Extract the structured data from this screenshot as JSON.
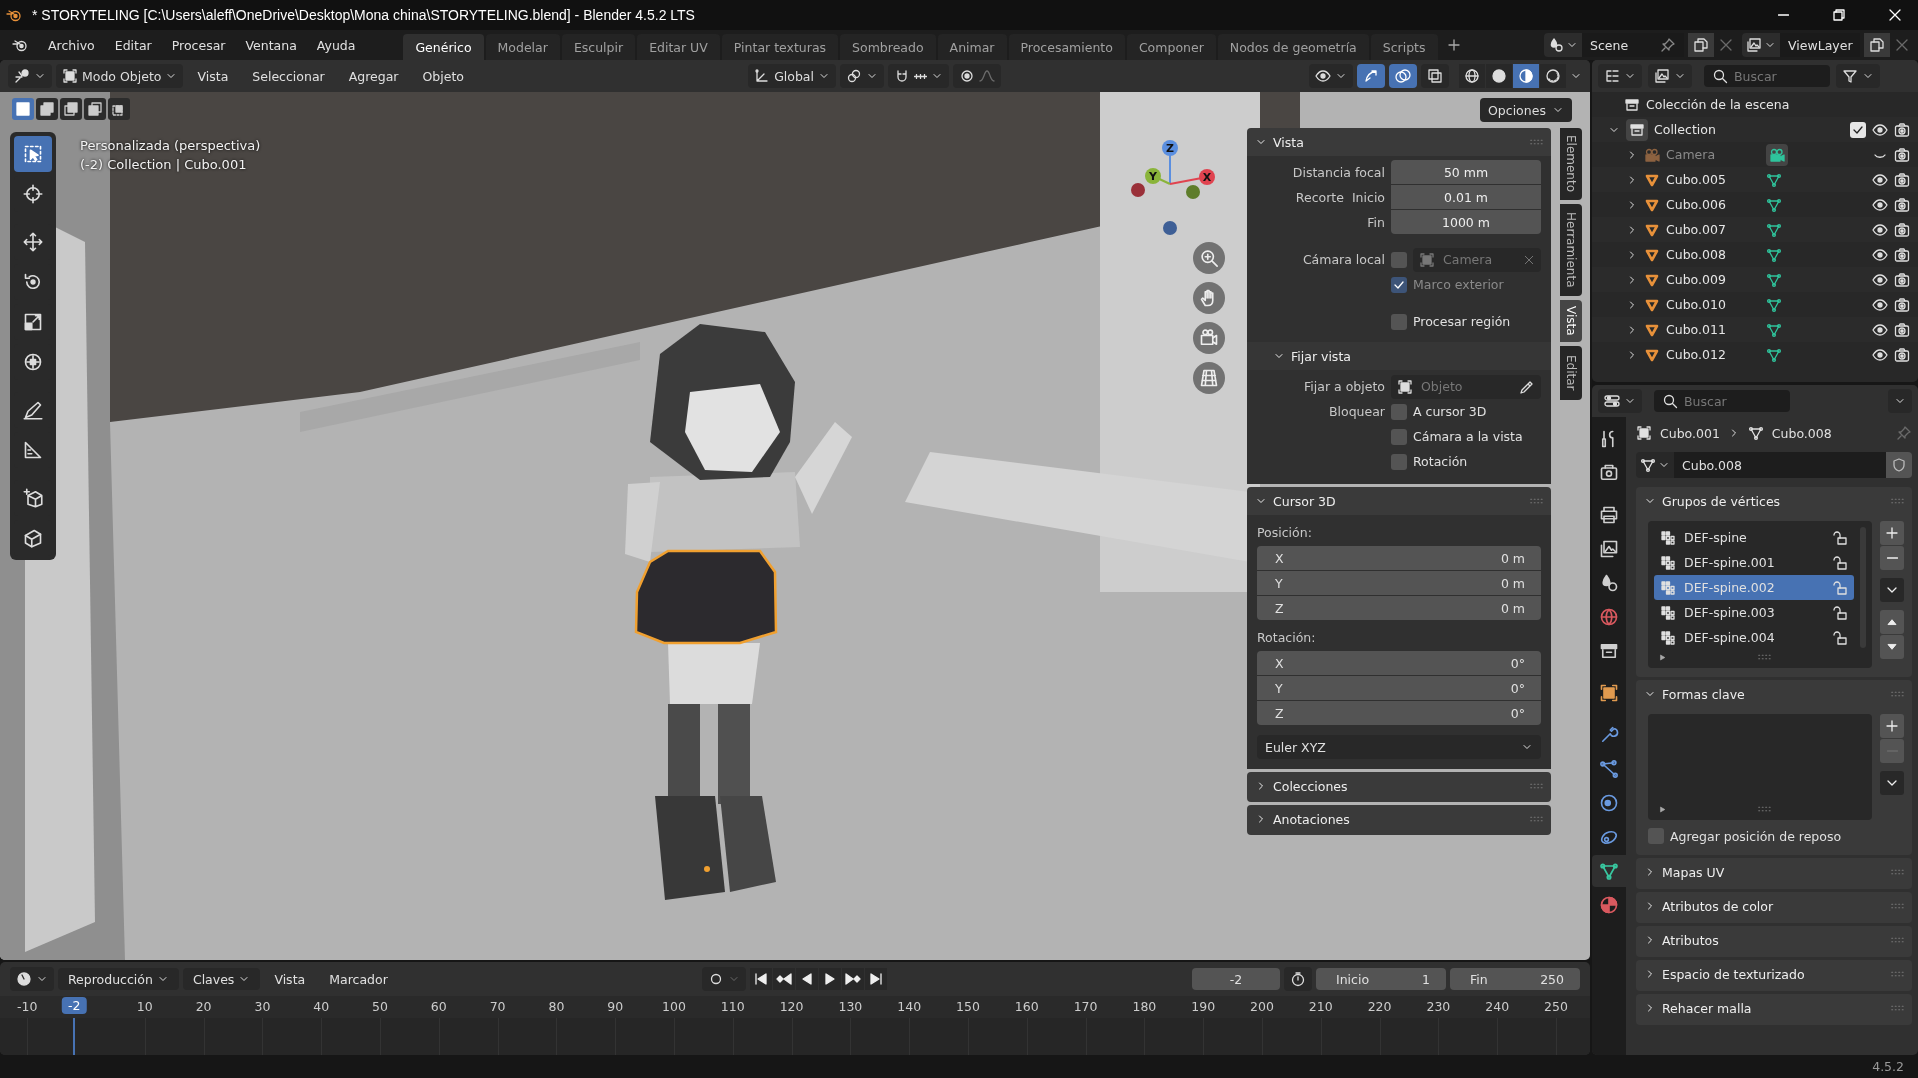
{
  "window": {
    "title": "* STORYTELING [C:\\Users\\aleff\\OneDrive\\Desktop\\Mona china\\STORYTELING.blend] - Blender 4.5.2 LTS"
  },
  "menu": [
    "Archivo",
    "Editar",
    "Procesar",
    "Ventana",
    "Ayuda"
  ],
  "workspaces": [
    {
      "label": "Genérico",
      "selected": true
    },
    {
      "label": "Modelar",
      "selected": false
    },
    {
      "label": "Esculpir",
      "selected": false
    },
    {
      "label": "Editar UV",
      "selected": false
    },
    {
      "label": "Pintar texturas",
      "selected": false
    },
    {
      "label": "Sombreado",
      "selected": false
    },
    {
      "label": "Animar",
      "selected": false
    },
    {
      "label": "Procesamiento",
      "selected": false
    },
    {
      "label": "Componer",
      "selected": false
    },
    {
      "label": "Nodos de geometría",
      "selected": false
    },
    {
      "label": "Scripts",
      "selected": false
    }
  ],
  "scene": {
    "name": "Scene"
  },
  "view_layer": {
    "name": "ViewLayer"
  },
  "viewport": {
    "mode": "Modo Objeto",
    "menus": [
      "Vista",
      "Seleccionar",
      "Agregar",
      "Objeto"
    ],
    "orientation": "Global",
    "options": "Opciones",
    "info": [
      "Personalizada (perspectiva)",
      "(-2) Collection | Cubo.001"
    ],
    "select_modes": [
      {
        "kind": "set",
        "selected": true
      },
      {
        "kind": "extend",
        "selected": false
      },
      {
        "kind": "subtract",
        "selected": false
      },
      {
        "kind": "invert",
        "selected": false
      },
      {
        "kind": "intersect",
        "selected": false
      }
    ],
    "tools": [
      {
        "kind": "select",
        "selected": true
      },
      {
        "kind": "crosshair",
        "selected": false
      },
      {
        "kind": "move",
        "selected": false
      },
      {
        "kind": "rotate",
        "selected": false
      },
      {
        "kind": "scale",
        "selected": false
      },
      {
        "kind": "transform",
        "selected": false
      },
      {
        "kind": "pencil",
        "selected": false
      },
      {
        "kind": "ruler",
        "selected": false
      },
      {
        "kind": "add-cube",
        "selected": false
      },
      {
        "kind": "cube-shear",
        "selected": false
      }
    ],
    "toggles": [
      {
        "kind": "gizmo",
        "on": true
      },
      {
        "kind": "overlay",
        "on": true
      },
      {
        "kind": "xray",
        "on": false
      }
    ],
    "shading": [
      {
        "kind": "wireframe",
        "selected": false
      },
      {
        "kind": "solid",
        "selected": false
      },
      {
        "kind": "material",
        "selected": true
      },
      {
        "kind": "rendered",
        "selected": false
      }
    ],
    "gizmo_axes": [
      "X",
      "Y",
      "Z"
    ]
  },
  "sidebar": {
    "tabs": [
      {
        "label": "Elemento",
        "selected": false
      },
      {
        "label": "Herramienta",
        "selected": false
      },
      {
        "label": "Vista",
        "selected": true
      },
      {
        "label": "Editar",
        "selected": false
      }
    ],
    "panels": [
      {
        "kind": "view",
        "title": "Vista",
        "expanded": true,
        "fields": [
          {
            "label": "Distancia focal",
            "value": "50 mm"
          },
          {
            "group": "Recorte",
            "label": "Inicio",
            "value": "0.01 m"
          },
          {
            "label": "Fin",
            "value": "1000 m"
          }
        ],
        "local_camera": {
          "label": "Cámara local",
          "checked": false,
          "placeholder": "Camera"
        },
        "options": [
          {
            "label": "Marco exterior",
            "checked": true,
            "disabled": true
          },
          {
            "label": "Procesar región",
            "checked": false,
            "disabled": false
          }
        ],
        "sub": {
          "title": "Fijar vista",
          "expanded": true,
          "object_label": "Fijar a objeto",
          "object_placeholder": "Objeto",
          "lock_label": "Bloquear",
          "locks": [
            {
              "label": "A cursor 3D",
              "checked": false
            },
            {
              "label": "Cámara a la vista",
              "checked": false
            },
            {
              "label": "Rotación",
              "checked": false
            }
          ]
        }
      },
      {
        "kind": "cursor",
        "title": "Cursor 3D",
        "expanded": true,
        "position_label": "Posición:",
        "position": [
          {
            "axis": "X",
            "value": "0 m"
          },
          {
            "axis": "Y",
            "value": "0 m"
          },
          {
            "axis": "Z",
            "value": "0 m"
          }
        ],
        "rotation_label": "Rotación:",
        "rotation": [
          {
            "axis": "X",
            "value": "0°"
          },
          {
            "axis": "Y",
            "value": "0°"
          },
          {
            "axis": "Z",
            "value": "0°"
          }
        ],
        "rotation_mode": "Euler XYZ"
      },
      {
        "kind": "collapsed",
        "title": "Colecciones",
        "expanded": false
      },
      {
        "kind": "collapsed",
        "title": "Anotaciones",
        "expanded": false
      }
    ]
  },
  "outliner": {
    "search_placeholder": "Buscar",
    "root": "Colección de la escena",
    "collection": {
      "label": "Collection",
      "expanded": true,
      "checked": true,
      "hidden": false,
      "children": [
        {
          "label": "Camera",
          "kind": "camera",
          "expanded": false,
          "hidden": true
        },
        {
          "label": "Cubo.005",
          "kind": "mesh",
          "expanded": false,
          "hidden": false
        },
        {
          "label": "Cubo.006",
          "kind": "mesh",
          "expanded": false,
          "hidden": false
        },
        {
          "label": "Cubo.007",
          "kind": "mesh",
          "expanded": false,
          "hidden": false
        },
        {
          "label": "Cubo.008",
          "kind": "mesh",
          "expanded": false,
          "hidden": false
        },
        {
          "label": "Cubo.009",
          "kind": "mesh",
          "expanded": false,
          "hidden": false
        },
        {
          "label": "Cubo.010",
          "kind": "mesh",
          "expanded": false,
          "hidden": false
        },
        {
          "label": "Cubo.011",
          "kind": "mesh",
          "expanded": false,
          "hidden": false
        },
        {
          "label": "Cubo.012",
          "kind": "mesh",
          "expanded": false,
          "hidden": false
        }
      ]
    }
  },
  "properties": {
    "search_placeholder": "Buscar",
    "tabs": [
      {
        "kind": "tool",
        "selected": false
      },
      {
        "kind": "render",
        "selected": false
      },
      {
        "kind": "output",
        "selected": false
      },
      {
        "kind": "view-layer",
        "selected": false
      },
      {
        "kind": "scene",
        "selected": false
      },
      {
        "kind": "world",
        "selected": false
      },
      {
        "kind": "collection",
        "selected": false
      },
      {
        "kind": "object",
        "selected": false
      },
      {
        "kind": "modifier",
        "selected": false
      },
      {
        "kind": "particles",
        "selected": false
      },
      {
        "kind": "physics",
        "selected": false
      },
      {
        "kind": "constraints",
        "selected": false
      },
      {
        "kind": "data",
        "selected": true
      },
      {
        "kind": "material",
        "selected": false
      }
    ],
    "object": "Cubo.001",
    "data": "Cubo.008",
    "data_name": "Cubo.008",
    "panels": [
      {
        "kind": "vertex-groups",
        "title": "Grupos de vértices",
        "expanded": true,
        "items": [
          {
            "label": "DEF-spine",
            "selected": false
          },
          {
            "label": "DEF-spine.001",
            "selected": false
          },
          {
            "label": "DEF-spine.002",
            "selected": true
          },
          {
            "label": "DEF-spine.003",
            "selected": false
          },
          {
            "label": "DEF-spine.004",
            "selected": false
          }
        ]
      },
      {
        "kind": "shape-keys",
        "title": "Formas clave",
        "expanded": true,
        "option": {
          "label": "Agregar posición de reposo",
          "checked": false
        }
      },
      {
        "kind": "collapsed",
        "title": "Mapas UV",
        "expanded": false
      },
      {
        "kind": "collapsed",
        "title": "Atributos de color",
        "expanded": false
      },
      {
        "kind": "collapsed",
        "title": "Atributos",
        "expanded": false
      },
      {
        "kind": "collapsed",
        "title": "Espacio de texturizado",
        "expanded": false
      },
      {
        "kind": "collapsed",
        "title": "Rehacer malla",
        "expanded": false
      }
    ]
  },
  "timeline": {
    "menus": [
      {
        "label": "Reproducción",
        "dropdown": true
      },
      {
        "label": "Claves",
        "dropdown": true
      },
      {
        "label": "Vista",
        "dropdown": false
      },
      {
        "label": "Marcador",
        "dropdown": false
      }
    ],
    "frame": "-2",
    "start_label": "Inicio",
    "start": "1",
    "end_label": "Fin",
    "end": "250",
    "current": "-2",
    "ticks": [
      "-10",
      "10",
      "20",
      "30",
      "40",
      "50",
      "60",
      "70",
      "80",
      "90",
      "100",
      "110",
      "120",
      "130",
      "140",
      "150",
      "160",
      "170",
      "180",
      "190",
      "200",
      "210",
      "220",
      "230",
      "240",
      "250"
    ]
  },
  "status": {
    "version": "4.5.2"
  }
}
